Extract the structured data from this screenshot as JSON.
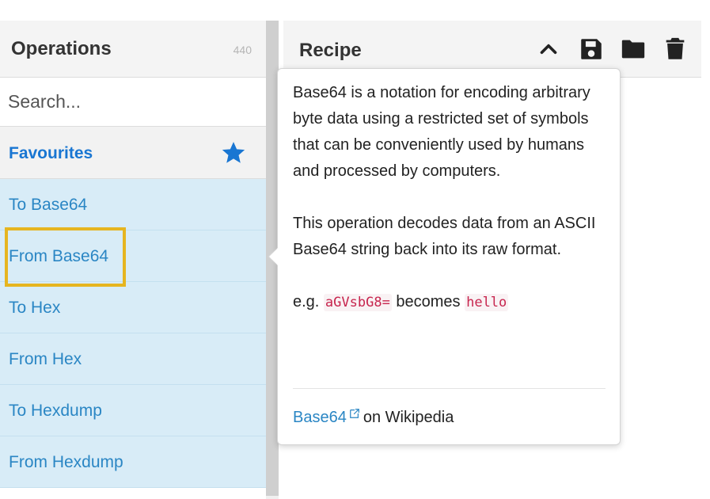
{
  "operations_panel": {
    "title": "Operations",
    "count": "440",
    "search_placeholder": "Search...",
    "favourites_label": "Favourites",
    "items": [
      {
        "label": "To Base64"
      },
      {
        "label": "From Base64"
      },
      {
        "label": "To Hex"
      },
      {
        "label": "From Hex"
      },
      {
        "label": "To Hexdump"
      },
      {
        "label": "From Hexdump"
      }
    ]
  },
  "recipe_panel": {
    "title": "Recipe",
    "icons": [
      "chevron-up-icon",
      "save-icon",
      "folder-icon",
      "trash-icon"
    ]
  },
  "popover": {
    "paragraph1": "Base64 is a notation for encoding arbitrary byte data using a restricted set of symbols that can be conveniently used by humans and processed by computers.",
    "paragraph2": "This operation decodes data from an ASCII Base64 string back into its raw format.",
    "example_prefix": "e.g.",
    "example_input": "aGVsbG8=",
    "example_middle": "becomes",
    "example_output": "hello",
    "link_text": "Base64",
    "link_suffix": "on Wikipedia"
  },
  "colors": {
    "accent_blue": "#1976d2",
    "item_bg": "#d8ecf7",
    "item_text": "#2a86c4",
    "highlight": "#e6b520",
    "code_text": "#c7254e"
  }
}
